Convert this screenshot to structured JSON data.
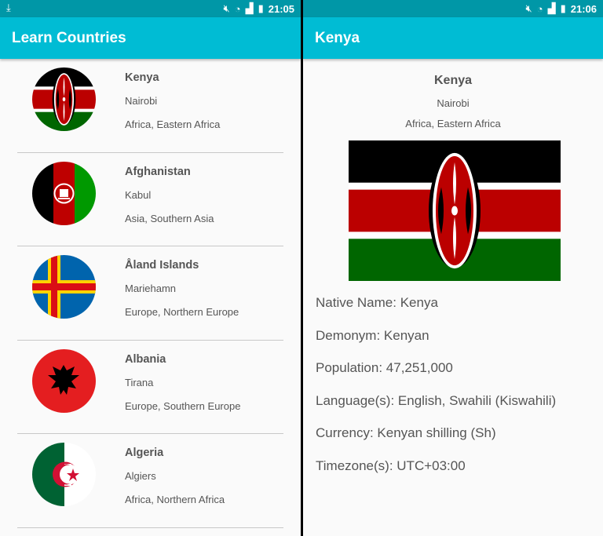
{
  "left_screen": {
    "status_bar": {
      "time": "21:05"
    },
    "app_bar": {
      "title": "Learn Countries"
    },
    "countries": [
      {
        "name": "Kenya",
        "capital": "Nairobi",
        "region": "Africa, Eastern Africa",
        "flag": "kenya-flag"
      },
      {
        "name": "Afghanistan",
        "capital": "Kabul",
        "region": "Asia, Southern Asia",
        "flag": "afghanistan-flag"
      },
      {
        "name": "Åland Islands",
        "capital": "Mariehamn",
        "region": "Europe, Northern Europe",
        "flag": "aland-flag"
      },
      {
        "name": "Albania",
        "capital": "Tirana",
        "region": "Europe, Southern Europe",
        "flag": "albania-flag"
      },
      {
        "name": "Algeria",
        "capital": "Algiers",
        "region": "Africa, Northern Africa",
        "flag": "algeria-flag"
      }
    ]
  },
  "right_screen": {
    "status_bar": {
      "time": "21:06"
    },
    "app_bar": {
      "title": "Kenya"
    },
    "detail": {
      "name": "Kenya",
      "capital": "Nairobi",
      "region": "Africa, Eastern Africa",
      "native_name": "Native Name: Kenya",
      "demonym": "Demonym: Kenyan",
      "population": "Population: 47,251,000",
      "languages": "Language(s): English, Swahili (Kiswahili)",
      "currency": "Currency: Kenyan shilling (Sh)",
      "timezones": "Timezone(s): UTC+03:00"
    }
  },
  "colors": {
    "status_bar": "#0097a7",
    "app_bar": "#00bcd4",
    "text": "#555555"
  }
}
